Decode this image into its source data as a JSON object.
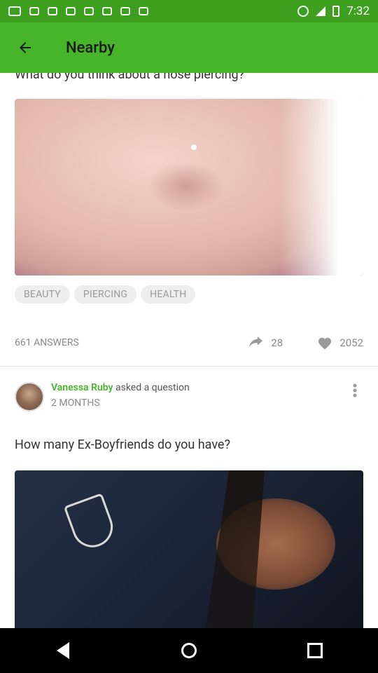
{
  "status_bar": {
    "time": "7:32"
  },
  "app_bar": {
    "title": "Nearby"
  },
  "post1": {
    "question": "What do you think about a nose piercing?",
    "tags": [
      "BEAUTY",
      "PIERCING",
      "HEALTH"
    ],
    "answers": "661 ANSWERS",
    "shares": "28",
    "likes": "2052"
  },
  "post2": {
    "author": "Vanessa Ruby",
    "action": " asked a question",
    "time": "2 MONTHS",
    "question": "How many Ex-Boyfriends do you have?"
  },
  "colors": {
    "primary": "#47b52a",
    "status": "#3d9f1e",
    "text": "#333333",
    "muted": "#8a8a8a"
  },
  "icons": {
    "back": "arrow-left-icon",
    "share": "share-icon",
    "like": "heart-icon",
    "more": "more-vert-icon"
  }
}
